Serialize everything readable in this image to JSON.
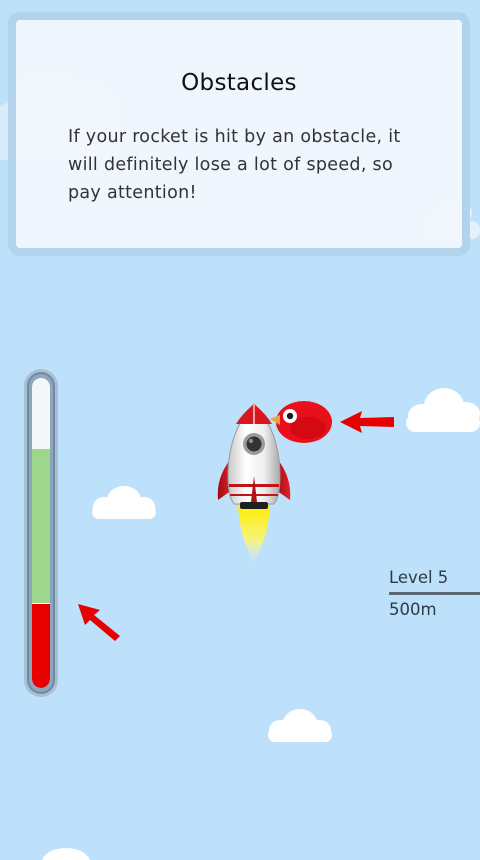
{
  "tutorial": {
    "title": "Obstacles",
    "body": "If your rocket is hit by an obstacle, it will definitely lose a lot of speed, so pay attention!"
  },
  "hud": {
    "level_label": "Level 5",
    "distance_label": "500m",
    "speed_meter": {
      "fill_fraction": 0.77,
      "danger_fraction": 0.27
    }
  },
  "sprites": {
    "rocket": "rocket-icon",
    "obstacle": "red-bird-icon",
    "pointers": [
      "arrow-left-icon",
      "arrow-up-left-icon"
    ]
  },
  "colors": {
    "sky": "#bde0fb",
    "meter_green": "#9ed68c",
    "meter_red": "#e60000",
    "arrow_red": "#e60000",
    "bird_red": "#e8101a"
  }
}
